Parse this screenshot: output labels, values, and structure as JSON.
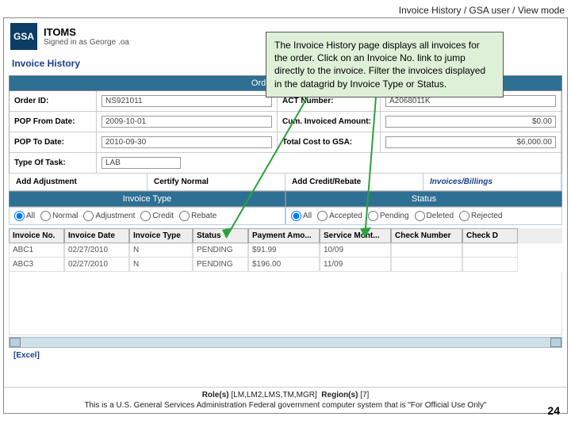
{
  "breadcrumb": "Invoice History / GSA user / View mode",
  "logo_text": "GSA",
  "app_title": "ITOMS",
  "signed_in": "Signed in as George  .oa",
  "page_title": "Invoice History",
  "section_header": "Order Information",
  "order": {
    "order_id_label": "Order ID:",
    "order_id": "NS921011",
    "act_label": "ACT Number:",
    "act": "A2068011K",
    "pop_from_label": "POP From Date:",
    "pop_from": "2009-10-01",
    "cum_label": "Cum. Invoiced Amount:",
    "cum": "$0.00",
    "pop_to_label": "POP To Date:",
    "pop_to": "2010-09-30",
    "total_label": "Total Cost to GSA:",
    "total": "$6,000.00",
    "type_label": "Type Of Task:",
    "type": "LAB"
  },
  "actions": {
    "add_adj": "Add Adjustment",
    "certify": "Certify Normal",
    "credit": "Add Credit/Rebate",
    "inv_bill": "Invoices/Billings"
  },
  "filters": {
    "inv_type_head": "Invoice Type",
    "status_head": "Status",
    "all": "All",
    "normal": "Normal",
    "adjustment": "Adjustment",
    "credit": "Credit",
    "rebate": "Rebate",
    "accepted": "Accepted",
    "pending": "Pending",
    "deleted": "Deleted",
    "rejected": "Rejected"
  },
  "grid_headers": {
    "c0": "Invoice No.",
    "c1": "Invoice Date",
    "c2": "Invoice Type",
    "c3": "Status",
    "c4": "Payment Amo...",
    "c5": "Service Mont...",
    "c6": "Check Number",
    "c7": "Check D"
  },
  "grid_rows": [
    {
      "no": "ABC1",
      "date": "02/27/2010",
      "type": "N",
      "status": "PENDING",
      "amt": "$91.99",
      "mo": "10/09",
      "check": "",
      "checkd": ""
    },
    {
      "no": "ABC3",
      "date": "02/27/2010",
      "type": "N",
      "status": "PENDING",
      "amt": "$196.00",
      "mo": "11/09",
      "check": "",
      "checkd": ""
    }
  ],
  "excel_link": "[Excel]",
  "footer": {
    "roles_lbl": "Role(s)",
    "roles": "[LM,LM2,LMS,TM,MGR]",
    "regions_lbl": "Region(s)",
    "regions": "[7]",
    "disclaimer": "This is a U.S. General Services Administration Federal government computer system that is \"For Official Use Only\""
  },
  "annotation": "The Invoice History page displays all invoices for the order. Click on an Invoice No. link to jump directly to the invoice.  Filter the invoices displayed in the datagrid by Invoice Type or Status.",
  "page_number": "24"
}
